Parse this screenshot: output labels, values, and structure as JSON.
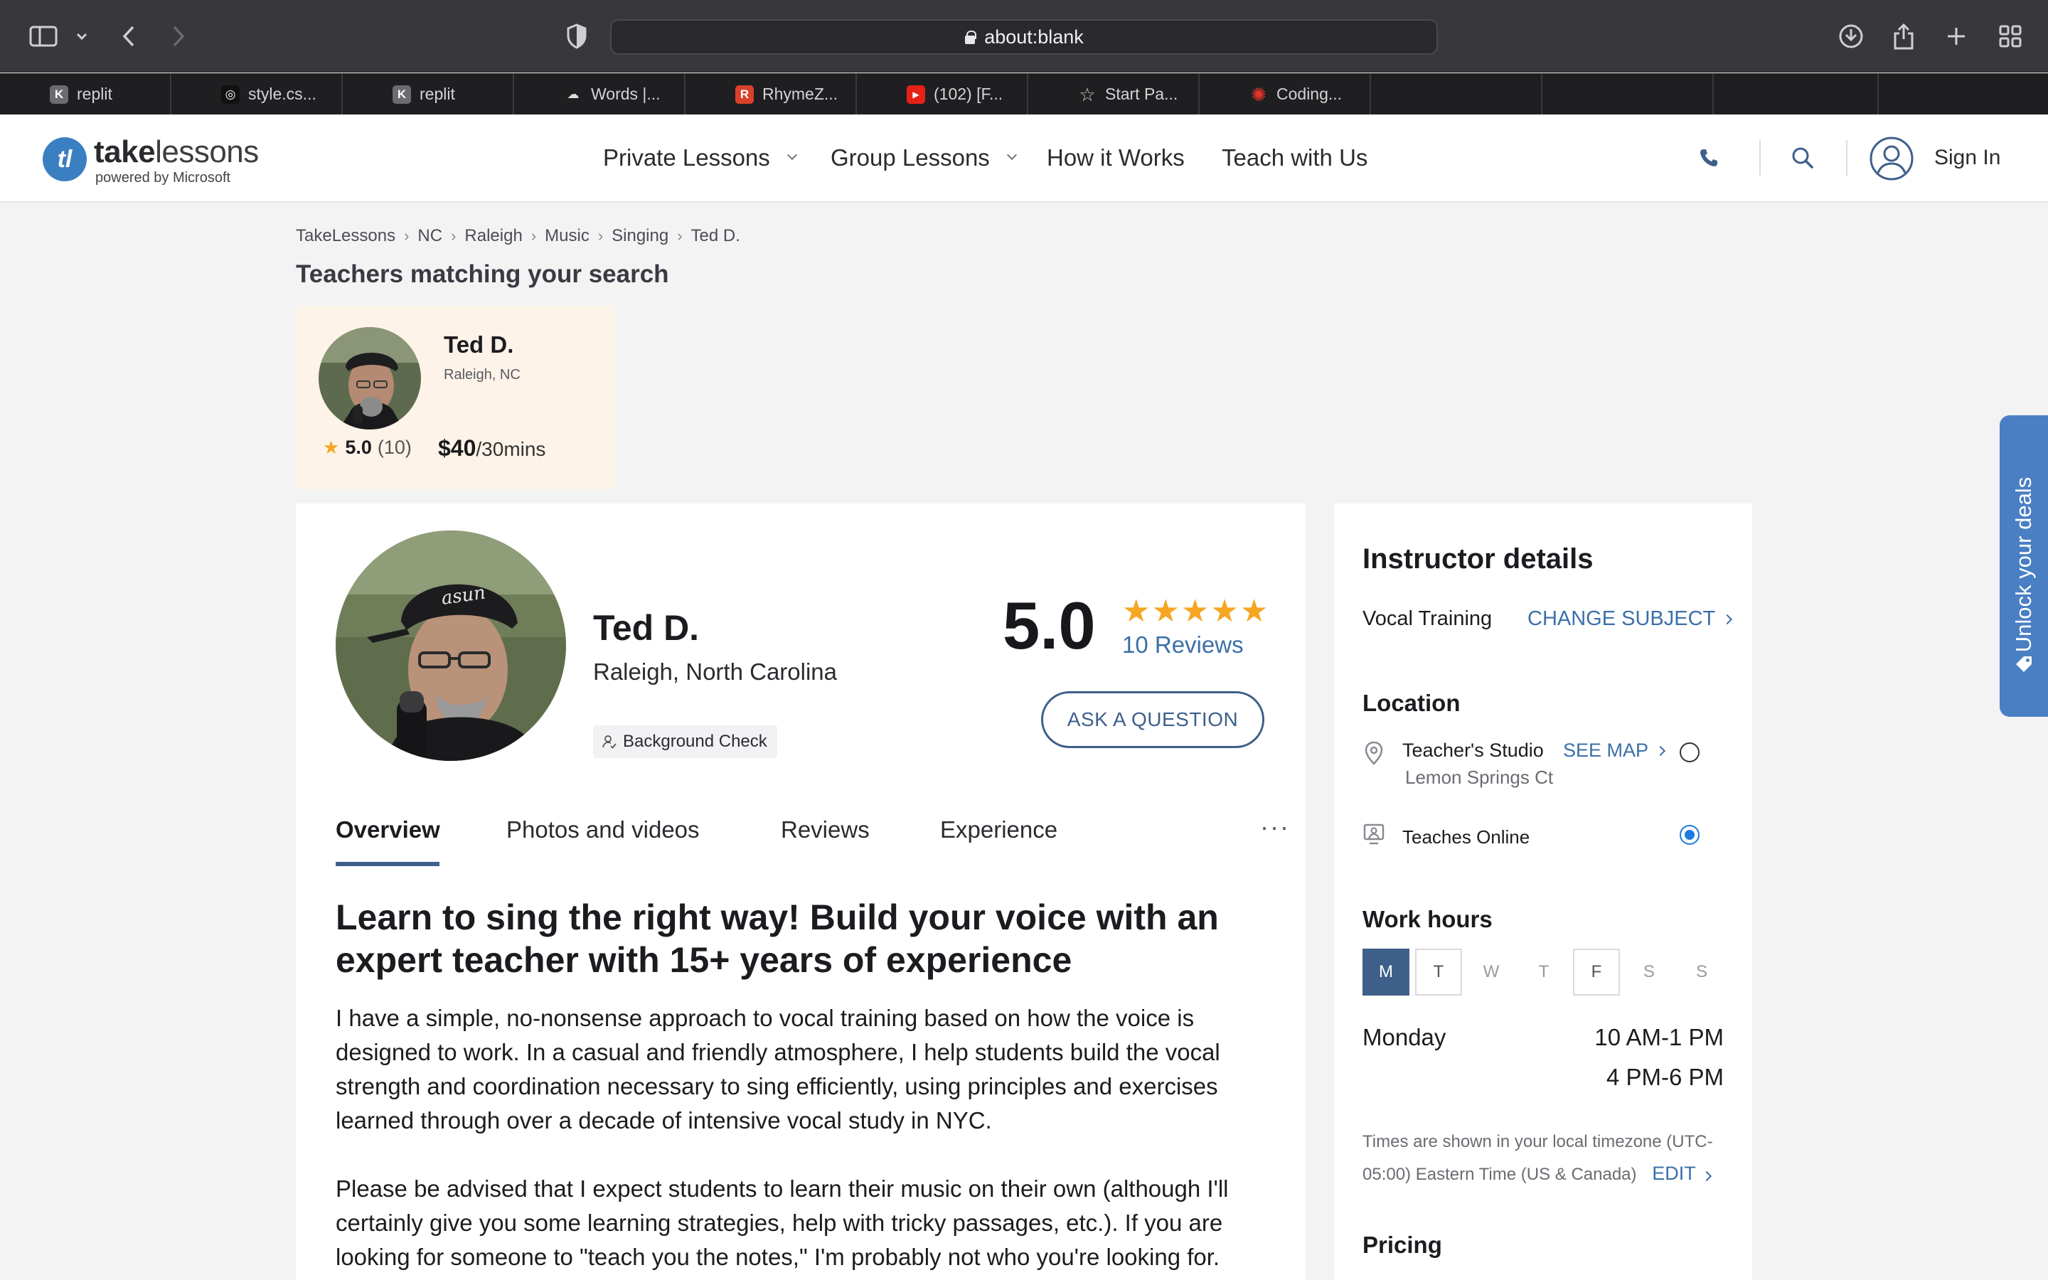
{
  "browser": {
    "url": "about:blank",
    "tabs": [
      {
        "label": "replit",
        "favicon": "K",
        "color": "#6b6b70"
      },
      {
        "label": "style.cs...",
        "favicon": "◎",
        "color": "#111111"
      },
      {
        "label": "replit",
        "favicon": "K",
        "color": "#6b6b70"
      },
      {
        "label": "Words |...",
        "favicon": "☁",
        "color": "#1f1f21"
      },
      {
        "label": "RhymeZ...",
        "favicon": "R",
        "color": "#d9412b"
      },
      {
        "label": "(102) [F...",
        "favicon": "▶",
        "color": "#e62117"
      },
      {
        "label": "Start Pa...",
        "favicon": "☆",
        "color": "#1f1f21"
      },
      {
        "label": "Coding...",
        "favicon": "✺",
        "color": "#1f1f21"
      }
    ]
  },
  "site": {
    "logo_bold": "take",
    "logo_rest": "lessons",
    "logo_mark": "tl",
    "logo_sub": "powered by Microsoft",
    "nav": {
      "private": "Private Lessons",
      "group": "Group Lessons",
      "how": "How it Works",
      "teach": "Teach with Us"
    },
    "sign_in": "Sign In"
  },
  "breadcrumbs": [
    "TakeLessons",
    "NC",
    "Raleigh",
    "Music",
    "Singing",
    "Ted D."
  ],
  "results_title": "Teachers matching your search",
  "result_card": {
    "name": "Ted D.",
    "location": "Raleigh, NC",
    "rating": "5.0",
    "count": "(10)",
    "price": "$40",
    "per": "/30mins"
  },
  "profile": {
    "name": "Ted D.",
    "location": "Raleigh, North Carolina",
    "background_check": "Background Check",
    "rating": "5.0",
    "stars": 5,
    "reviews": "10 Reviews",
    "ask_button": "ASK A QUESTION",
    "tabs": [
      "Overview",
      "Photos and videos",
      "Reviews",
      "Experience"
    ],
    "more": "···",
    "headline": "Learn to sing the right way! Build your voice with an expert teacher with 15+ years of experience",
    "para1": "I have a simple, no-nonsense approach to vocal training based on how the voice is designed to work. In a casual and friendly atmosphere, I help students build the vocal strength and coordination necessary to sing efficiently, using principles and exercises learned through over a decade of intensive vocal study in NYC.",
    "para2": "Please be advised that I expect students to learn their music on their own (although I'll certainly give you some learning strategies, help with tricky passages, etc.). If you are looking for someone to \"teach you the notes,\" I'm probably not who you're looking for."
  },
  "details": {
    "title": "Instructor details",
    "subject": "Vocal Training",
    "change_subject": "CHANGE SUBJECT",
    "location_heading": "Location",
    "studio": "Teacher's Studio",
    "studio_address": "Lemon Springs Ct",
    "see_map": "SEE MAP",
    "online": "Teaches Online",
    "selected_location": "online",
    "work_hours_heading": "Work hours",
    "days": [
      "M",
      "T",
      "W",
      "T",
      "F",
      "S",
      "S"
    ],
    "selected_day": "Monday",
    "hours": [
      "10 AM-1 PM",
      "4 PM-6 PM"
    ],
    "tz_note": "Times are shown in your local timezone (UTC-05:00) Eastern Time (US & Canada)",
    "edit": "EDIT",
    "pricing_heading": "Pricing"
  },
  "deals_tab": "Unlock your deals",
  "colors": {
    "accent": "#3e5f8a",
    "link": "#3b6fa8",
    "star": "#f5a623",
    "card_bg": "#fdf3e8",
    "deals": "#4a7fc4"
  }
}
